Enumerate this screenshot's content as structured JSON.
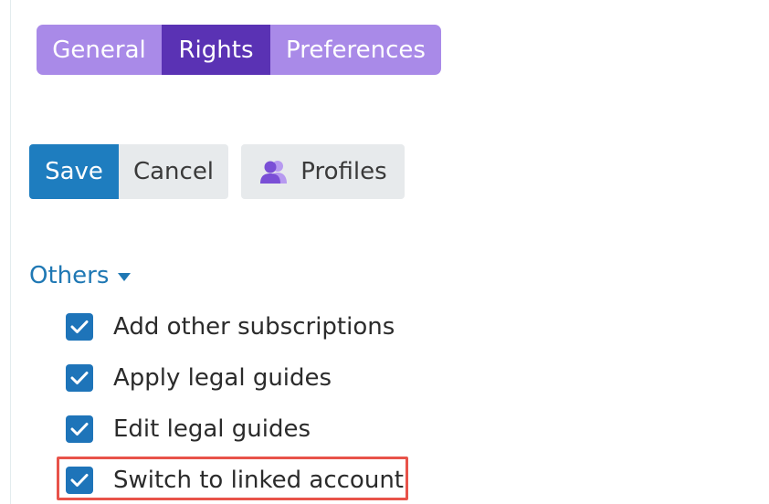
{
  "tabs": [
    {
      "label": "General",
      "active": false
    },
    {
      "label": "Rights",
      "active": true
    },
    {
      "label": "Preferences",
      "active": false
    }
  ],
  "toolbar": {
    "save_label": "Save",
    "cancel_label": "Cancel",
    "profiles_label": "Profiles",
    "profiles_icon": "users-icon"
  },
  "section": {
    "title": "Others",
    "expanded": true,
    "options": [
      {
        "label": "Add other subscriptions",
        "checked": true
      },
      {
        "label": "Apply legal guides",
        "checked": true
      },
      {
        "label": "Edit legal guides",
        "checked": true
      },
      {
        "label": "Switch to linked account",
        "checked": true,
        "highlighted": true
      }
    ]
  },
  "colors": {
    "tab_inactive": "#a98ae8",
    "tab_active": "#5a32b4",
    "primary": "#1e7dbf",
    "checkbox": "#1e74b9",
    "highlight": "#e8534a",
    "profiles_icon": "#7a4fd6"
  }
}
